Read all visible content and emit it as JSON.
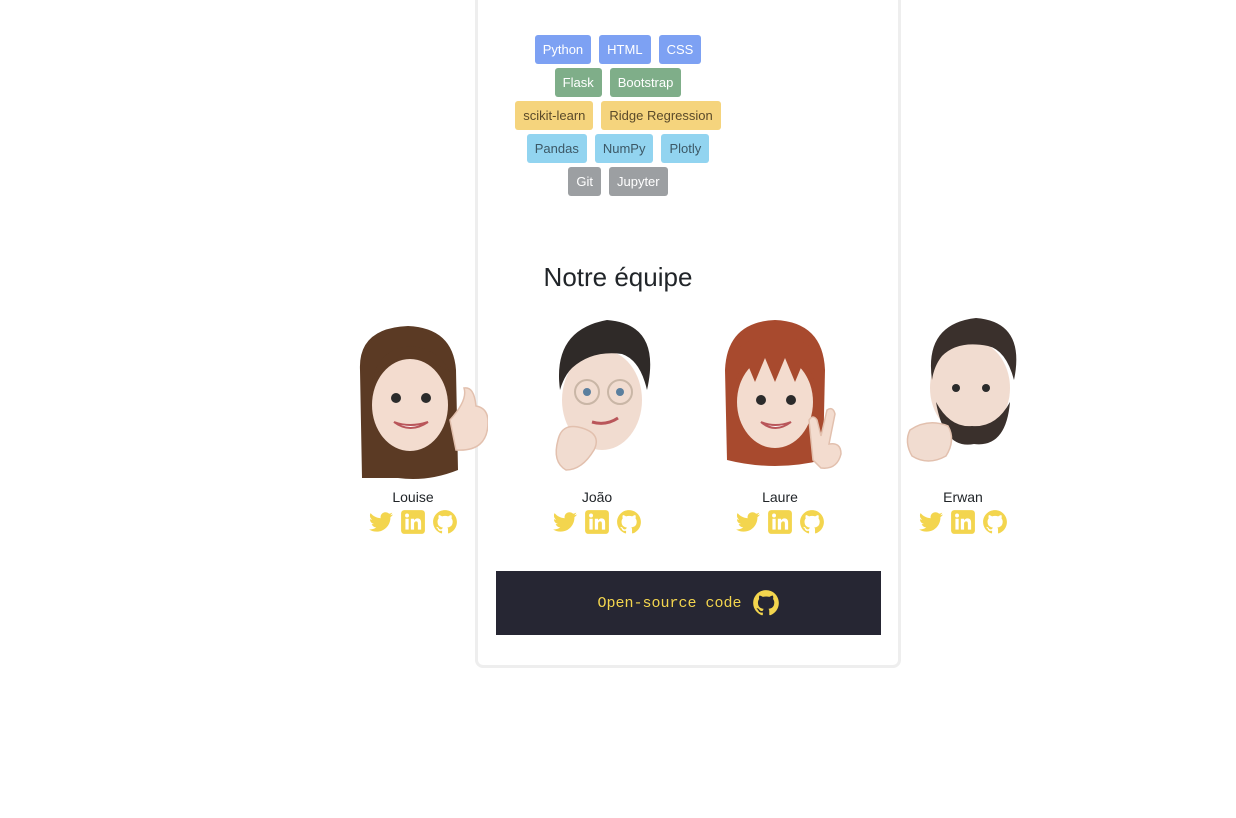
{
  "tags": [
    [
      {
        "label": "Python",
        "color": "blue"
      },
      {
        "label": "HTML",
        "color": "blue"
      },
      {
        "label": "CSS",
        "color": "blue"
      }
    ],
    [
      {
        "label": "Flask",
        "color": "green"
      },
      {
        "label": "Bootstrap",
        "color": "green"
      }
    ],
    [
      {
        "label": "scikit-learn",
        "color": "yellow"
      },
      {
        "label": "Ridge Regression",
        "color": "yellow"
      }
    ],
    [
      {
        "label": "Pandas",
        "color": "cyan"
      },
      {
        "label": "NumPy",
        "color": "cyan"
      },
      {
        "label": "Plotly",
        "color": "cyan"
      }
    ],
    [
      {
        "label": "Git",
        "color": "gray"
      },
      {
        "label": "Jupyter",
        "color": "gray"
      }
    ]
  ],
  "team": {
    "title": "Notre équipe",
    "members": [
      {
        "name": "Louise",
        "avatar": "memoji-thumbs-up"
      },
      {
        "name": "João",
        "avatar": "memoji-thinking-glasses"
      },
      {
        "name": "Laure",
        "avatar": "memoji-peace-sign"
      },
      {
        "name": "Erwan",
        "avatar": "memoji-fist-bump"
      }
    ],
    "social_icons": [
      "twitter-icon",
      "linkedin-icon",
      "github-icon"
    ],
    "icon_color": "#f3d54e"
  },
  "footer": {
    "code_label": "Open-source code",
    "code_icon": "github-icon",
    "background": "#262633",
    "accent": "#f3d54e"
  }
}
